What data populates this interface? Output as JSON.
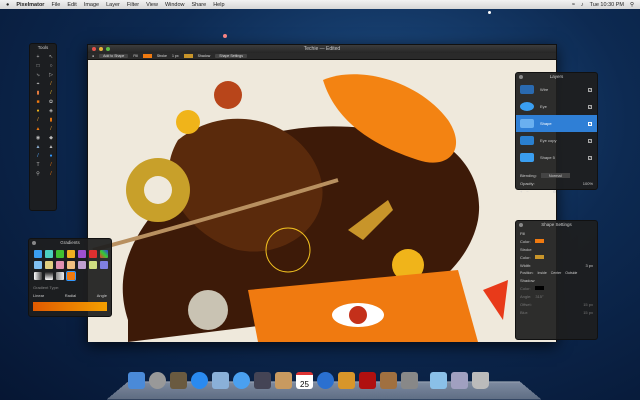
{
  "menubar": {
    "app": "Pixelmator",
    "items": [
      "File",
      "Edit",
      "Image",
      "Layer",
      "Filter",
      "View",
      "Window",
      "Share",
      "Help"
    ],
    "clock": "Tue 10:30 PM"
  },
  "window": {
    "title": "Techie — Edited",
    "toolbar": {
      "mode": "Add to Shape",
      "fill_label": "Fill",
      "stroke_label": "Stroke",
      "stroke_width": "1 px",
      "shadow_label": "Shadow",
      "shape_settings": "Shape Settings"
    },
    "fill_color": "#f07a10",
    "stroke_color": "#c8952a"
  },
  "tools": {
    "title": "Tools"
  },
  "layers": {
    "title": "Layers",
    "items": [
      {
        "name": "Wire",
        "checked": true
      },
      {
        "name": "Eye",
        "checked": true
      },
      {
        "name": "Shape",
        "checked": true,
        "selected": true
      },
      {
        "name": "Eye copy",
        "checked": true
      },
      {
        "name": "Shape 5",
        "checked": true
      }
    ],
    "blending_label": "Blending:",
    "blending_value": "Normal",
    "opacity_label": "Opacity:",
    "opacity_value": "100%"
  },
  "shape_settings": {
    "title": "Shape Settings",
    "fill": "Fill",
    "fill_color_label": "Color:",
    "stroke": "Stroke",
    "stroke_color_label": "Color:",
    "width_label": "Width:",
    "width_value": "3 px",
    "position_label": "Position:",
    "positions": [
      "Inside",
      "Center",
      "Outside"
    ],
    "shadow": "Shadow",
    "shadow_color_label": "Color:",
    "angle_label": "Angle:",
    "angle_value": "315°",
    "offset_label": "Offset:",
    "offset_value": "15 px",
    "blur_label": "Blur:",
    "blur_value": "15 px"
  },
  "gradients": {
    "title": "Gradients",
    "type_label": "Gradient Type:",
    "types": [
      "Linear",
      "Radial",
      "Angle"
    ]
  },
  "dock": {
    "apps": [
      "Finder",
      "Launchpad",
      "Mission Control",
      "App Store",
      "Preview",
      "Safari",
      "FaceTime",
      "Contacts",
      "Calendar",
      "iTunes",
      "Pixelmator",
      "Photo Booth",
      "iPhoto",
      "System Preferences",
      "Applications",
      "Documents",
      "Trash"
    ],
    "calendar_day": "25"
  }
}
